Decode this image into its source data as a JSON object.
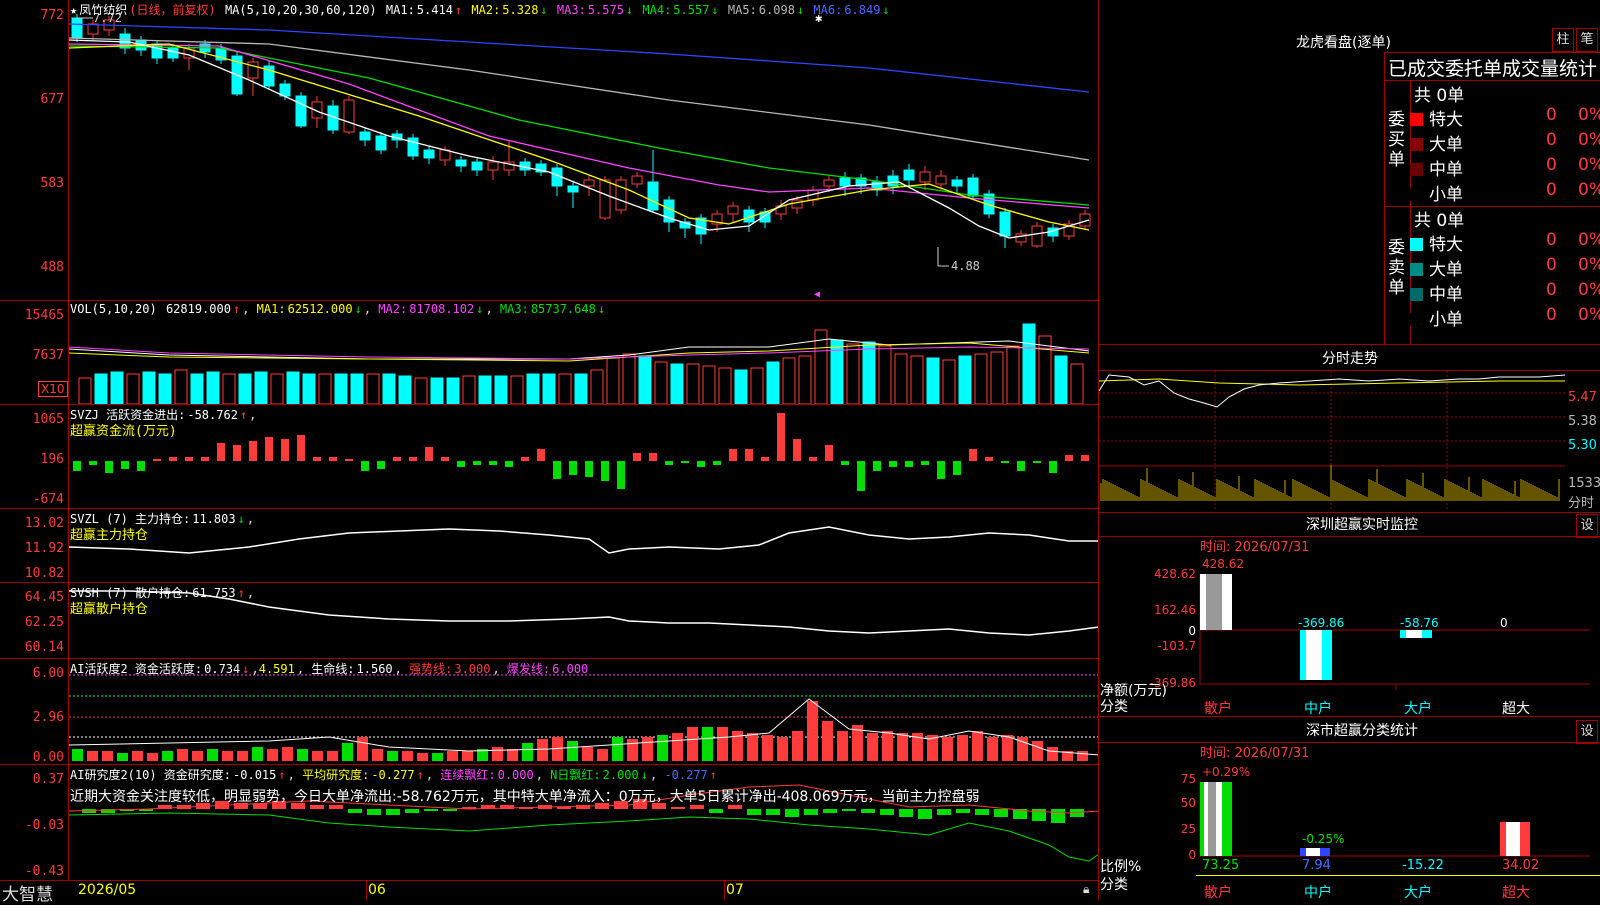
{
  "colors": {
    "up": "#ff3b3b",
    "down": "#00ffff",
    "grid": "#a00000",
    "ma1": "#ffffff",
    "ma2": "#ffff00",
    "ma3": "#ff44ff",
    "ma4": "#00dd00",
    "ma5": "#b8b8b8",
    "ma6": "#2d45ff"
  },
  "main": {
    "star": "★",
    "stock_name": "凤竹纺织",
    "period": "(日线，前复权)",
    "ma_label": "MA(5,10,20,30,60,120)",
    "ma_values": [
      {
        "label": "MA1:",
        "value": "5.414",
        "arrow": "↑"
      },
      {
        "label": "MA2:",
        "value": "5.328",
        "arrow": "↓"
      },
      {
        "label": "MA3:",
        "value": "5.575",
        "arrow": "↓"
      },
      {
        "label": "MA4:",
        "value": "5.557",
        "arrow": "↓"
      },
      {
        "label": "MA5:",
        "value": "6.098",
        "arrow": "↓"
      },
      {
        "label": "MA6:",
        "value": "6.849",
        "arrow": "↓"
      }
    ],
    "y_ticks": [
      "772",
      "677",
      "583",
      "488"
    ],
    "high_marker": "7.72",
    "low_marker": "4.88"
  },
  "vol": {
    "label": "VOL(5,10,20)",
    "value": "62819.000",
    "value_arrow": "↑",
    "mas": [
      {
        "label": "MA1:",
        "value": "62512.000",
        "arrow": "↓"
      },
      {
        "label": "MA2:",
        "value": "81708.102",
        "arrow": "↓"
      },
      {
        "label": "MA3:",
        "value": "85737.648",
        "arrow": "↓"
      }
    ],
    "y_ticks": [
      "15465",
      "7637"
    ],
    "unit": "X10"
  },
  "svzj": {
    "label": "SVZJ  活跃资金进出:",
    "value": "-58.762",
    "arrow": "↑",
    "subtitle": "超赢资金流(万元)",
    "y_ticks": [
      "1065",
      "196",
      "-674"
    ]
  },
  "svzl": {
    "label": "SVZL (7) 主力持仓:",
    "value": "11.803",
    "arrow": "↓",
    "subtitle": "超赢主力持仓",
    "y_ticks": [
      "13.02",
      "11.92",
      "10.82"
    ]
  },
  "svsh": {
    "label": "SVSH (7) 散户持仓:",
    "value": "61.753",
    "arrow": "↑",
    "subtitle": "超赢散户持仓",
    "y_ticks": [
      "64.45",
      "62.25",
      "60.14"
    ]
  },
  "ai_active": {
    "label": "AI活跃度2 资金活跃度:",
    "value1": "0.734",
    "arrow1": "↓",
    "value2": "4.591",
    "life_label": "生命线:",
    "life_value": "1.560",
    "strong_label": "强势线:",
    "strong_value": "3.000",
    "burst_label": "爆发线:",
    "burst_value": "6.000",
    "y_ticks": [
      "6.00",
      "2.96",
      "0.00"
    ]
  },
  "ai_research": {
    "label": "AI研究度2(10) 资金研究度:",
    "value": "-0.015",
    "arrow": "↑",
    "avg_label": "平均研究度:",
    "avg_value": "-0.277",
    "avg_arrow": "↑",
    "red_label": "连续飘红:",
    "red_value": "0.000",
    "nred_label": "N日飘红:",
    "nred_value": "2.000",
    "nred_arrow": "↓",
    "last_value": "-0.277",
    "last_arrow": "↑",
    "commentary": "近期大资金关注度较低，明显弱势，今日大单净流出:-58.762万元，其中特大单净流入：0万元，大单5日累计净出-408.069万元，当前主力控盘弱",
    "y_ticks": [
      "0.37",
      "-0.03",
      "-0.43"
    ]
  },
  "x_axis": {
    "brand": "大智慧",
    "labels": [
      "2026/05",
      "06",
      "07"
    ]
  },
  "dragon_tiger": {
    "title": "龙虎看盘(逐单)",
    "btn_col": "柱",
    "btn_pen": "笔",
    "header": "已成交委托单成交量统计",
    "buy_label": "委买单",
    "sell_label": "委卖单",
    "buy_total": "共 0单",
    "sell_total": "共 0单",
    "buy_rows": [
      {
        "name": "特大",
        "count": "0",
        "pct": "0%",
        "color": "#ff0000"
      },
      {
        "name": "大单",
        "count": "0",
        "pct": "0%",
        "color": "#8b0000"
      },
      {
        "name": "中单",
        "count": "0",
        "pct": "0%",
        "color": "#6a0000"
      },
      {
        "name": "小单",
        "count": "0",
        "pct": "0%",
        "color": "#000000"
      }
    ],
    "sell_rows": [
      {
        "name": "特大",
        "count": "0",
        "pct": "0%",
        "color": "#00ffff"
      },
      {
        "name": "大单",
        "count": "0",
        "pct": "0%",
        "color": "#008b8b"
      },
      {
        "name": "中单",
        "count": "0",
        "pct": "0%",
        "color": "#006a6a"
      },
      {
        "name": "小单",
        "count": "0",
        "pct": "0%",
        "color": "#000000"
      }
    ]
  },
  "intraday": {
    "title": "分时走势",
    "prices": [
      "5.47",
      "5.38",
      "5.30"
    ],
    "vol_label": "1533",
    "time_label": "分时"
  },
  "sz_monitor": {
    "title": "深圳超赢实时监控",
    "set_btn": "设",
    "time": "时间: 2026/07/31",
    "y_ticks": [
      "428.62",
      "162.46",
      "0",
      "-103.7",
      "-369.86"
    ],
    "ylabel": "净额(万元)",
    "xlabel": "分类",
    "categories": [
      "散户",
      "中户",
      "大户",
      "超大"
    ],
    "values_text": [
      "428.62",
      "-369.86",
      "-58.76",
      "0"
    ]
  },
  "sz_class": {
    "title": "深市超赢分类统计",
    "set_btn": "设",
    "time": "时间: 2026/07/31",
    "y_ticks": [
      "75",
      "50",
      "25",
      "0"
    ],
    "ylabel": "比例%",
    "xlabel": "分类",
    "categories": [
      "散户",
      "中户",
      "大户",
      "超大"
    ],
    "top_labels": [
      "+0.29%",
      "-0.25%"
    ],
    "values_text": [
      "73.25",
      "7.94",
      "-15.22",
      "34.02"
    ]
  }
}
